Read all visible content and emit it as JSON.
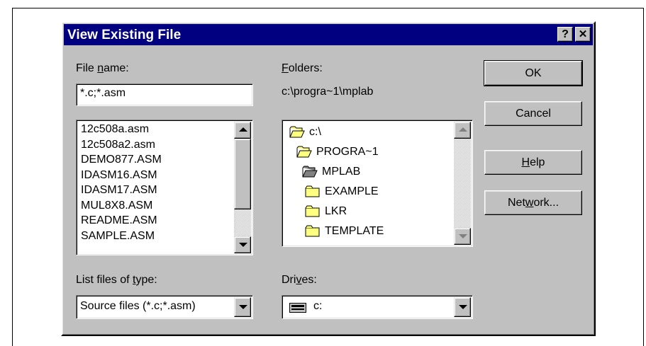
{
  "window": {
    "title": "View Existing File",
    "help_button": "?",
    "close_button": "✕"
  },
  "file_name": {
    "label_pre": "File ",
    "label_u": "n",
    "label_post": "ame:",
    "value": "*.c;*.asm"
  },
  "file_list": [
    "12c508a.asm",
    "12c508a2.asm",
    "DEMO877.ASM",
    "IDASM16.ASM",
    "IDASM17.ASM",
    "MUL8X8.ASM",
    "README.ASM",
    "SAMPLE.ASM"
  ],
  "folders": {
    "label_u": "F",
    "label_post": "olders:",
    "current_path": "c:\\progra~1\\mplab",
    "tree": [
      {
        "name": "c:\\",
        "icon": "open-folder-icon"
      },
      {
        "name": "PROGRA~1",
        "icon": "open-folder-icon"
      },
      {
        "name": "MPLAB",
        "icon": "open-folder-selected-icon"
      },
      {
        "name": "EXAMPLE",
        "icon": "folder-icon"
      },
      {
        "name": "LKR",
        "icon": "folder-icon"
      },
      {
        "name": "TEMPLATE",
        "icon": "folder-icon"
      }
    ]
  },
  "file_type": {
    "label_pre": "List files of ",
    "label_u": "t",
    "label_post": "ype:",
    "value": "Source files (*.c;*.asm)"
  },
  "drives": {
    "label_pre": "Dri",
    "label_u": "v",
    "label_post": "es:",
    "value": "c:",
    "icon": "drive-icon"
  },
  "buttons": {
    "ok": "OK",
    "cancel": "Cancel",
    "help_u": "H",
    "help_post": "elp",
    "network_pre": "Net",
    "network_u": "w",
    "network_post": "ork..."
  }
}
